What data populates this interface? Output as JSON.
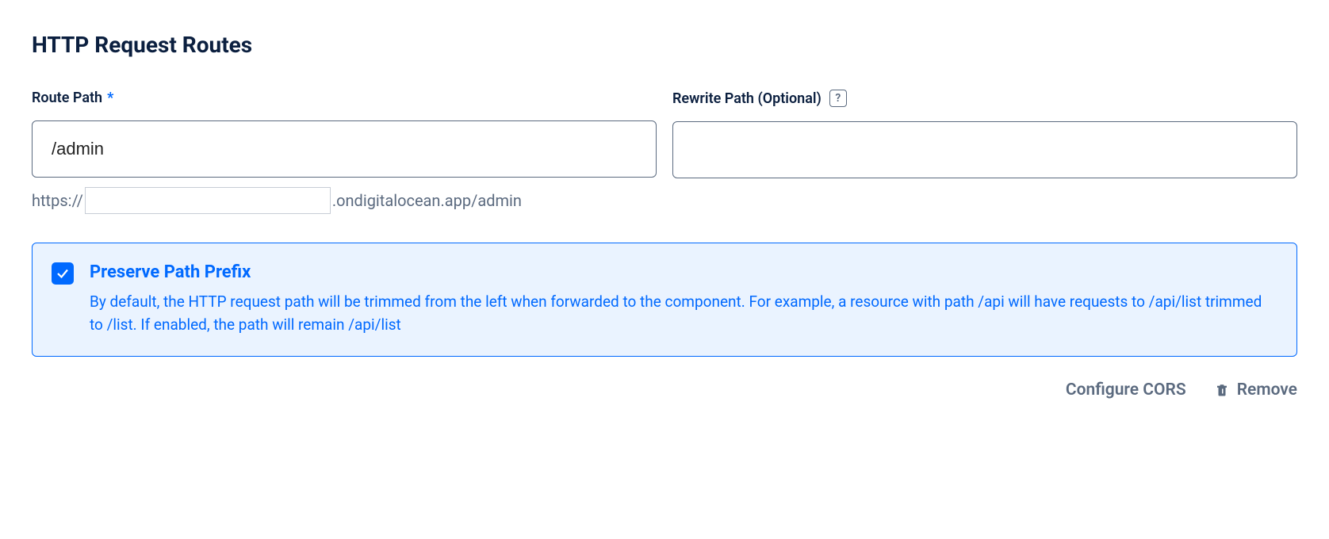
{
  "title": "HTTP Request Routes",
  "fields": {
    "routePath": {
      "label": "Route Path",
      "required": "*",
      "value": "/admin"
    },
    "rewritePath": {
      "label": "Rewrite Path (Optional)",
      "helpGlyph": "?",
      "value": ""
    }
  },
  "urlPreview": {
    "prefix": "https://",
    "subdomain": "",
    "suffix": ".ondigitalocean.app/admin"
  },
  "preservePrefix": {
    "checked": true,
    "title": "Preserve Path Prefix",
    "description": "By default, the HTTP request path will be trimmed from the left when forwarded to the component. For example, a resource with path /api will have requests to /api/list trimmed to /list. If enabled, the path will remain /api/list"
  },
  "actions": {
    "configureCors": "Configure CORS",
    "remove": "Remove"
  }
}
